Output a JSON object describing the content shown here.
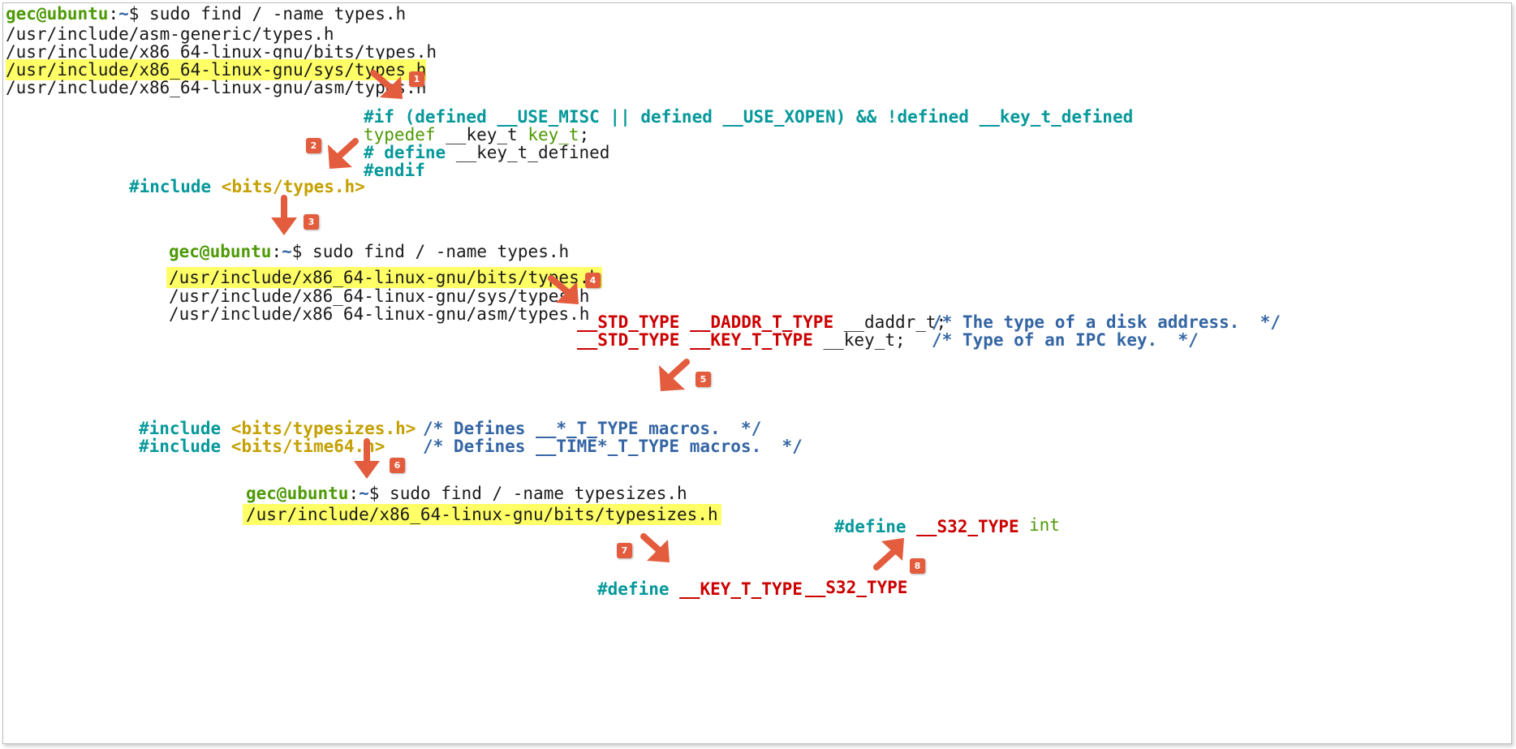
{
  "prompt": {
    "user": "gec@ubuntu",
    "sep": ":",
    "path": "~",
    "dollar": "$ "
  },
  "cmd1": "sudo find / -name types.h",
  "result1": [
    "/usr/include/asm-generic/types.h",
    "/usr/include/x86_64-linux-gnu/bits/types.h",
    "/usr/include/x86_64-linux-gnu/sys/types.h",
    "/usr/include/x86_64-linux-gnu/asm/types.h"
  ],
  "sys_snippet": {
    "if_line": "#if (defined __USE_MISC || defined __USE_XOPEN) && !defined __key_t_defined",
    "typedef_kw": "typedef",
    "typedef_type": " __key_t ",
    "typedef_name": "key_t",
    "typedef_semi": ";",
    "define_kw": "# define",
    "define_name": " __key_t_defined",
    "endif": "#endif"
  },
  "include1": {
    "kw": "#include ",
    "file": "<bits/types.h>"
  },
  "cmd2": "sudo find / -name types.h",
  "result2": [
    "/usr/include/x86_64-linux-gnu/bits/types.h",
    "/usr/include/x86_64-linux-gnu/sys/types.h",
    "/usr/include/x86 64-linux-gnu/asm/types.h"
  ],
  "bits_snippet": [
    {
      "macro": "__STD_TYPE",
      "type": "__DADDR_T_TYPE",
      "name": " __daddr_t;",
      "comment": "/* The type of a disk address.  */"
    },
    {
      "macro": "__STD_TYPE",
      "type": "__KEY_T_TYPE",
      "name": " __key_t;",
      "comment": "/* Type of an IPC key.  */"
    }
  ],
  "includes2": [
    {
      "kw": "#include ",
      "file": "<bits/typesizes.h>",
      "comment": "/* Defines __*_T_TYPE macros.  */"
    },
    {
      "kw": "#include ",
      "file": "<bits/time64.h>",
      "comment": "/* Defines __TIME*_T_TYPE macros.  */"
    }
  ],
  "cmd3": "sudo find / -name typesizes.h",
  "result3": "/usr/include/x86_64-linux-gnu/bits/typesizes.h",
  "typesizes": {
    "key_define_kw": "#define ",
    "key_define_name": "__KEY_T_TYPE",
    "key_define_value": "__S32_TYPE",
    "s32_define_kw": "#define ",
    "s32_define_name": "__S32_TYPE",
    "s32_define_value": "int"
  },
  "badges": [
    "1",
    "2",
    "3",
    "4",
    "5",
    "6",
    "7",
    "8"
  ],
  "colors": {
    "arrow": "#e25c3d",
    "highlight": "#ffff66"
  }
}
